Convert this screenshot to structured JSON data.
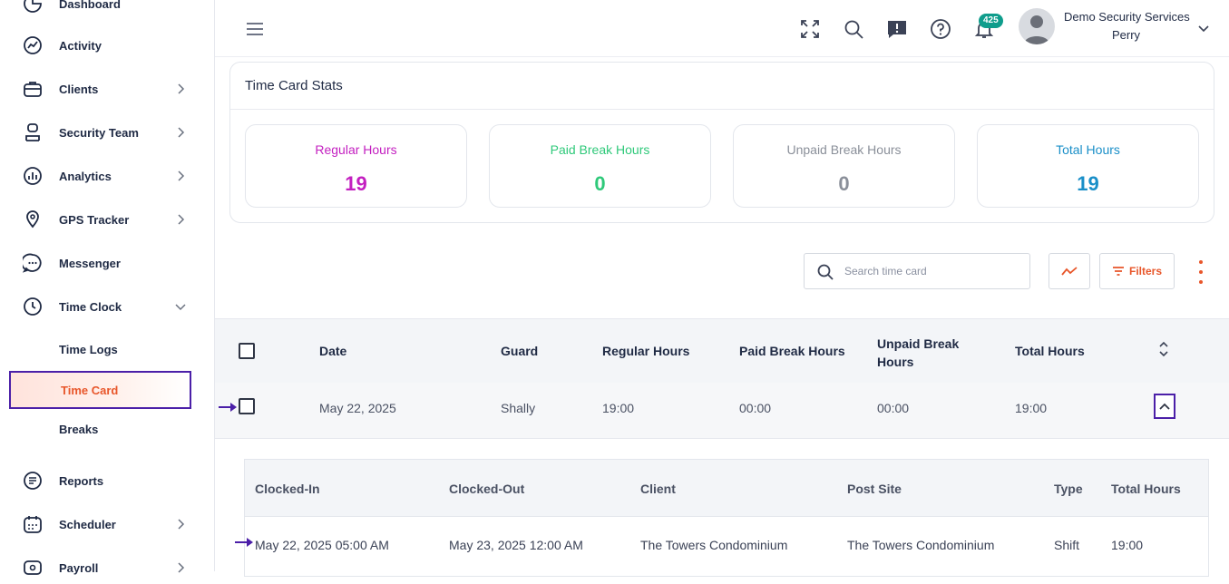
{
  "sidebar": {
    "items": [
      {
        "label": "Dashboard"
      },
      {
        "label": "Activity"
      },
      {
        "label": "Clients"
      },
      {
        "label": "Security Team"
      },
      {
        "label": "Analytics"
      },
      {
        "label": "GPS Tracker"
      },
      {
        "label": "Messenger"
      },
      {
        "label": "Time Clock"
      },
      {
        "label": "Reports"
      },
      {
        "label": "Scheduler"
      },
      {
        "label": "Payroll"
      }
    ],
    "time_clock_sub": [
      {
        "label": "Time Logs"
      },
      {
        "label": "Time Card"
      },
      {
        "label": "Breaks"
      }
    ]
  },
  "topbar": {
    "notification_count": "425",
    "company": "Demo Security Services",
    "user": "Perry"
  },
  "stats": {
    "title": "Time Card Stats",
    "cards": [
      {
        "label": "Regular Hours",
        "value": "19",
        "color": "#c31fc0"
      },
      {
        "label": "Paid Break Hours",
        "value": "0",
        "color": "#2fc97a"
      },
      {
        "label": "Unpaid Break Hours",
        "value": "0",
        "color": "#8a8f99"
      },
      {
        "label": "Total Hours",
        "value": "19",
        "color": "#1a8fc8"
      }
    ]
  },
  "toolbar": {
    "search_placeholder": "Search time card",
    "filters_label": "Filters"
  },
  "table": {
    "headers": {
      "date": "Date",
      "guard": "Guard",
      "regular": "Regular Hours",
      "paid_break": "Paid Break Hours",
      "unpaid_break_1": "Unpaid Break",
      "unpaid_break_2": "Hours",
      "total": "Total Hours"
    },
    "rows": [
      {
        "date": "May 22, 2025",
        "guard": "Shally",
        "regular": "19:00",
        "paid_break": "00:00",
        "unpaid_break": "00:00",
        "total": "19:00"
      }
    ]
  },
  "detail": {
    "headers": {
      "clocked_in": "Clocked-In",
      "clocked_out": "Clocked-Out",
      "client": "Client",
      "post_site": "Post Site",
      "type": "Type",
      "total": "Total Hours"
    },
    "rows": [
      {
        "clocked_in": "May 22, 2025 05:00 AM",
        "clocked_out": "May 23, 2025 12:00 AM",
        "client": "The Towers Condominium",
        "post_site": "The Towers Condominium",
        "type": "Shift",
        "total": "19:00"
      }
    ]
  },
  "colors": {
    "accent": "#e8562a",
    "highlight": "#4b1fa8",
    "badge": "#0f9d8c"
  }
}
